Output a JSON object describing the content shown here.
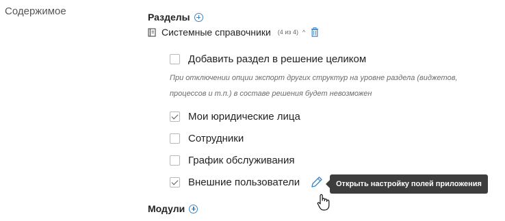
{
  "left_label": "Содержимое",
  "sections": {
    "title": "Разделы",
    "catalog": {
      "name": "Системные справочники",
      "count": "(4 из 4)",
      "caret": "^"
    },
    "add_whole": {
      "label": "Добавить раздел в решение целиком",
      "checked": false
    },
    "hint_line1": "При отключении опции экспорт других структур на уровне раздела (виджетов,",
    "hint_line2": "процессов и т.п.) в составе решения будет невозможен",
    "items": [
      {
        "label": "Мои юридические лица",
        "checked": true
      },
      {
        "label": "Сотрудники",
        "checked": false
      },
      {
        "label": "График обслуживания",
        "checked": false
      },
      {
        "label": "Внешние пользователи",
        "checked": true
      }
    ]
  },
  "tooltip": "Открыть настройку полей приложения",
  "modules": {
    "title": "Модули"
  },
  "colors": {
    "accent": "#3b86c9",
    "tooltip_bg": "#3d3d3d"
  },
  "icons": [
    "plus-circle-icon",
    "book-icon",
    "trash-icon",
    "pencil-icon",
    "hand-cursor-icon"
  ]
}
